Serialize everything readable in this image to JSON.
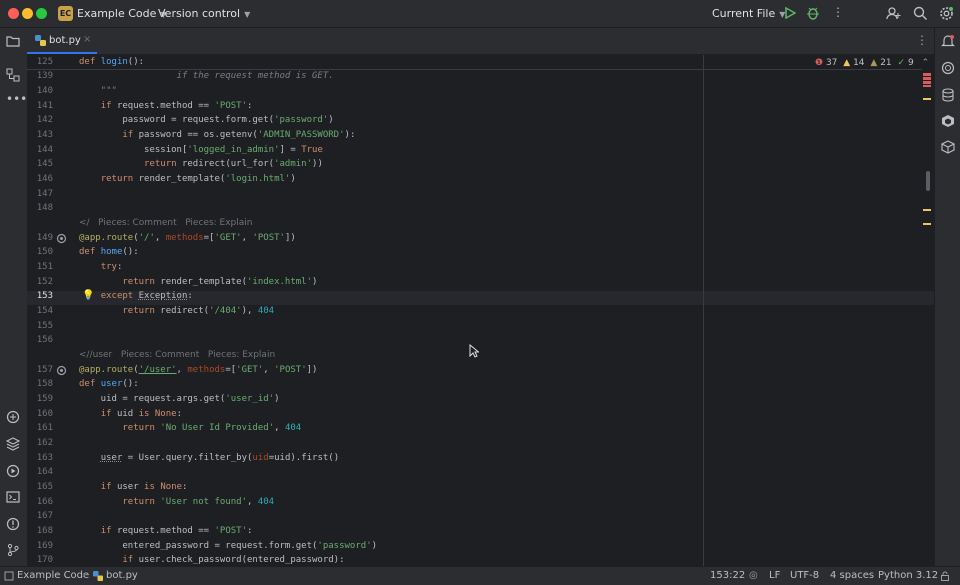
{
  "titlebar": {
    "project_badge": "EC",
    "project_name": "Example Code",
    "vcs": "Version control",
    "run_config": "Current File"
  },
  "tab": {
    "filename": "bot.py"
  },
  "inspections": {
    "errors": "37",
    "warnings": "14",
    "weak_warnings": "21",
    "ok": "9"
  },
  "code_vision": {
    "piece_comment": "Pieces: Comment",
    "piece_explain": "Pieces: Explain",
    "route_user": "/user"
  },
  "lines": {
    "l125": "125",
    "l139": "139",
    "l140": "140",
    "l141": "141",
    "l142": "142",
    "l143": "143",
    "l144": "144",
    "l145": "145",
    "l146": "146",
    "l147": "147",
    "l148": "148",
    "l149": "149",
    "l150": "150",
    "l151": "151",
    "l152": "152",
    "l153": "153",
    "l154": "154",
    "l155": "155",
    "l156": "156",
    "l157": "157",
    "l158": "158",
    "l159": "159",
    "l160": "160",
    "l161": "161",
    "l162": "162",
    "l163": "163",
    "l164": "164",
    "l165": "165",
    "l166": "166",
    "l167": "167",
    "l168": "168",
    "l169": "169",
    "l170": "170"
  },
  "status": {
    "breadcrumb_project": "Example Code",
    "breadcrumb_file": "bot.py",
    "position": "153:22",
    "line_sep": "LF",
    "encoding": "UTF-8",
    "indent": "4 spaces",
    "interpreter": "Python 3.12"
  },
  "colors": {
    "accent": "#3574f0",
    "error": "#db5c5c",
    "warning": "#f2c55c",
    "ok": "#5fb865"
  }
}
